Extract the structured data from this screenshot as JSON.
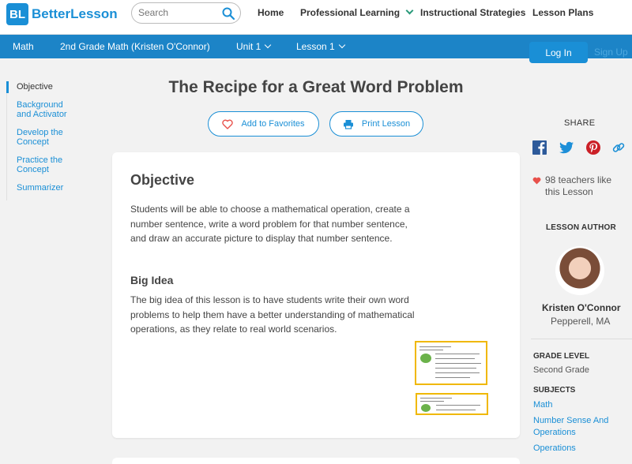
{
  "header": {
    "logo_badge": "BL",
    "logo_text": "BetterLesson",
    "search_placeholder": "Search",
    "nav": [
      {
        "label": "Home"
      },
      {
        "label": "Professional Learning"
      },
      {
        "label": "Instructional Strategies"
      },
      {
        "label": "Lesson Plans"
      }
    ]
  },
  "subnav": {
    "items": [
      {
        "label": "Math"
      },
      {
        "label": "2nd Grade Math (Kristen O'Connor)"
      },
      {
        "label": "Unit 1"
      },
      {
        "label": "Lesson 1"
      }
    ],
    "login_label": "Log In",
    "signup_label": "Sign Up"
  },
  "sidebar": {
    "items": [
      {
        "label": "Objective"
      },
      {
        "label": "Background and Activator"
      },
      {
        "label": "Develop the Concept"
      },
      {
        "label": "Practice the Concept"
      },
      {
        "label": "Summarizer"
      }
    ]
  },
  "lesson": {
    "title": "The Recipe for a Great Word Problem",
    "favorite_label": "Add to Favorites",
    "print_label": "Print Lesson",
    "objective_heading": "Objective",
    "objective_text": "Students will be able to choose a mathematical operation, create a number sentence, write a word problem for that number sentence, and draw an accurate picture to display that number sentence.",
    "big_idea_heading": "Big Idea",
    "big_idea_text": "The big idea of this lesson is to have students write their own word problems to help them have a better understanding of mathematical operations, as they relate to real world scenarios."
  },
  "aside": {
    "share_label": "SHARE",
    "share_icons": [
      "facebook-icon",
      "twitter-icon",
      "pinterest-icon",
      "link-icon"
    ],
    "likes_text": "98 teachers like this Lesson",
    "author_heading": "LESSON AUTHOR",
    "author_name": "Kristen O'Connor",
    "author_location": "Pepperell, MA",
    "grade_heading": "GRADE LEVEL",
    "grade_value": "Second Grade",
    "subjects_heading": "SUBJECTS",
    "subjects": [
      "Math",
      "Number Sense And Operations",
      "Operations"
    ]
  },
  "colors": {
    "brand": "#1a8fd6",
    "subnav": "#1c84c7",
    "accent_green": "#2a9a7a",
    "heart": "#e8514b",
    "thumb_border": "#f0b800"
  }
}
